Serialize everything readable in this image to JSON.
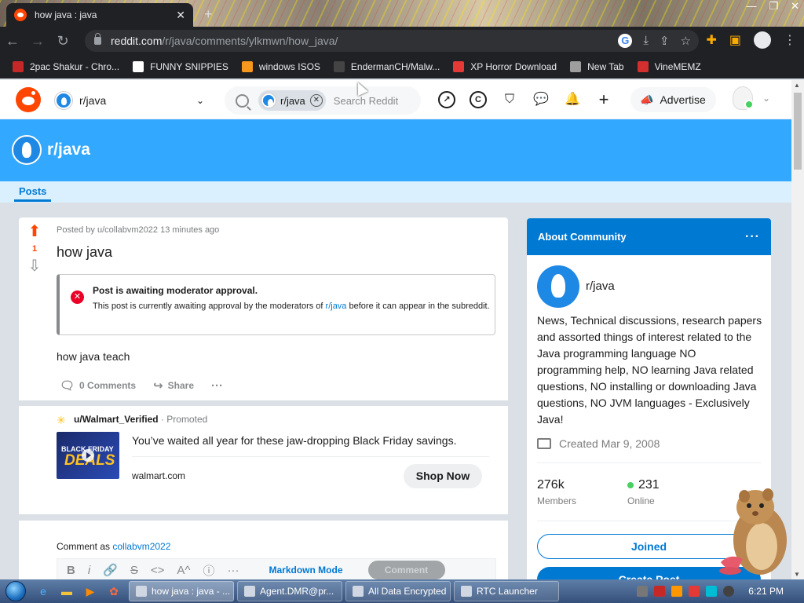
{
  "browser": {
    "tab_title": "how java : java",
    "tab_close": "✕",
    "new_tab": "+",
    "url_host": "reddit.com",
    "url_path": "/r/java/comments/ylkmwn/how_java/",
    "bookmarks": [
      {
        "label": "2pac Shakur - Chro...",
        "icon": "recording-icon",
        "color": "#c62828"
      },
      {
        "label": "FUNNY SNIPPIES",
        "icon": "h-letter-icon",
        "color": "#ffffff"
      },
      {
        "label": "windows ISOS",
        "icon": "ph-logo-icon",
        "color": "#f7971d"
      },
      {
        "label": "EndermanCH/Malw...",
        "icon": "yp-logo-icon",
        "color": "#444444"
      },
      {
        "label": "XP Horror Download",
        "icon": "x-mark-icon",
        "color": "#e53935"
      },
      {
        "label": "New Tab",
        "icon": "globe-icon",
        "color": "#9e9e9e"
      },
      {
        "label": "VineMEMZ",
        "icon": "r-logo-icon",
        "color": "#d32f2f"
      }
    ]
  },
  "reddit_header": {
    "community": "r/java",
    "search_chip": "r/java",
    "search_placeholder": "Search Reddit",
    "advertise": "Advertise"
  },
  "banner": {
    "name": "r/java",
    "tab_posts": "Posts"
  },
  "post": {
    "vote_count": "1",
    "meta": "Posted by u/collabvm2022 13 minutes ago",
    "title": "how java",
    "notice_heading": "Post is awaiting moderator approval.",
    "notice_body_pre": "This post is currently awaiting approval by the moderators of ",
    "notice_link": "r/java",
    "notice_body_post": " before it can appear in the subreddit.",
    "body": "how java teach",
    "comments": "0 Comments",
    "share": "Share"
  },
  "promoted": {
    "user": "u/Walmart_Verified",
    "sep": " · ",
    "tag": "Promoted",
    "thumb_line1": "BLACK FRIDAY",
    "thumb_line2": "DEALS",
    "headline": "You’ve waited all year for these jaw-dropping Black Friday savings.",
    "domain": "walmart.com",
    "cta": "Shop Now"
  },
  "comment_box": {
    "comment_as": "Comment as ",
    "username": "collabvm2022",
    "markdown_mode": "Markdown Mode",
    "submit": "Comment"
  },
  "about": {
    "heading": "About Community",
    "name": "r/java",
    "description": "News, Technical discussions, research papers and assorted things of interest related to the Java programming language NO programming help, NO learning Java related questions, NO installing or downloading Java questions, NO JVM languages - Exclusively Java!",
    "created": "Created Mar 9, 2008",
    "members_count": "276k",
    "members_label": "Members",
    "online_count": "231",
    "online_label": "Online",
    "joined": "Joined",
    "create_post": "Create Post"
  },
  "taskbar": {
    "items": [
      {
        "label": "how java : java - ...",
        "active": true
      },
      {
        "label": "Agent.DMR@pr...",
        "active": false
      },
      {
        "label": "All Data Encrypted",
        "active": false
      },
      {
        "label": "RTC Launcher",
        "active": false
      }
    ],
    "clock": "6:21 PM"
  },
  "colors": {
    "reddit_orange": "#ff4500",
    "banner_blue": "#33a8ff",
    "primary_blue": "#0079d3",
    "chrome_dark": "#202124"
  }
}
